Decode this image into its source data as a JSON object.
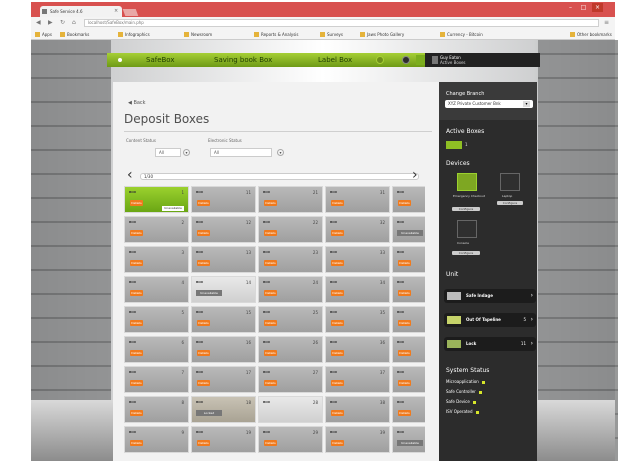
{
  "browser": {
    "tab_title": "Safe Service 4.6",
    "url": "localhost/SafeBox/main.php",
    "bookmarks": [
      "Apps",
      "Bookmarks",
      "Infographics",
      "Newsroom",
      "Reports & Analysis",
      "Surveys",
      "Jaws Photo Gallery",
      "Currency - Bitcoin",
      "Other bookmarks"
    ]
  },
  "topnav": {
    "items": [
      "SafeBox",
      "Saving book Box",
      "Label Box"
    ],
    "user_name": "Guy Eaton",
    "user_status": "Active Boxes"
  },
  "main": {
    "back_label": "Back",
    "title": "Deposit Boxes",
    "filter1_label": "Content Status",
    "filter1_value": "All",
    "filter2_label": "Electronic Status",
    "filter2_value": "All",
    "page_field": "1/30"
  },
  "cells": [
    {
      "num": "1",
      "style": "green",
      "btn": "Details",
      "extra": "Unavailable"
    },
    {
      "num": "11",
      "style": "",
      "btn": "Details"
    },
    {
      "num": "21",
      "style": "",
      "btn": "Details"
    },
    {
      "num": "31",
      "style": "",
      "btn": "Details"
    },
    {
      "num": "41",
      "style": "",
      "btn": "Details"
    },
    {
      "num": "2",
      "style": "",
      "btn": "Details"
    },
    {
      "num": "12",
      "style": "",
      "btn": "Details"
    },
    {
      "num": "22",
      "style": "",
      "btn": "Details"
    },
    {
      "num": "32",
      "style": "",
      "btn": "Details"
    },
    {
      "num": "42",
      "style": "",
      "btn": "Details",
      "tag": "Unavailable"
    },
    {
      "num": "3",
      "style": "",
      "btn": "Details"
    },
    {
      "num": "13",
      "style": "",
      "btn": "Details"
    },
    {
      "num": "23",
      "style": "",
      "btn": "Details"
    },
    {
      "num": "33",
      "style": "",
      "btn": "Details"
    },
    {
      "num": "43",
      "style": "",
      "btn": "Details"
    },
    {
      "num": "4",
      "style": "",
      "btn": "Details"
    },
    {
      "num": "14",
      "style": "light",
      "tag": "Unavailable"
    },
    {
      "num": "24",
      "style": "",
      "btn": "Details"
    },
    {
      "num": "34",
      "style": "",
      "btn": "Details"
    },
    {
      "num": "44",
      "style": "",
      "btn": "Details"
    },
    {
      "num": "5",
      "style": "",
      "btn": "Details"
    },
    {
      "num": "15",
      "style": "",
      "btn": "Details"
    },
    {
      "num": "25",
      "style": "",
      "btn": "Details"
    },
    {
      "num": "35",
      "style": "",
      "btn": "Details"
    },
    {
      "num": "45",
      "style": "",
      "btn": "Details"
    },
    {
      "num": "6",
      "style": "",
      "btn": "Details"
    },
    {
      "num": "16",
      "style": "",
      "btn": "Details"
    },
    {
      "num": "26",
      "style": "",
      "btn": "Details"
    },
    {
      "num": "36",
      "style": "",
      "btn": "Details"
    },
    {
      "num": "46",
      "style": "",
      "btn": "Details"
    },
    {
      "num": "7",
      "style": "",
      "btn": "Details"
    },
    {
      "num": "17",
      "style": "",
      "btn": "Details"
    },
    {
      "num": "27",
      "style": "",
      "btn": "Details"
    },
    {
      "num": "37",
      "style": "",
      "btn": "Details"
    },
    {
      "num": "47",
      "style": "",
      "btn": "Details"
    },
    {
      "num": "8",
      "style": "",
      "btn": "Details"
    },
    {
      "num": "18",
      "style": "tan",
      "tag": "Locked"
    },
    {
      "num": "28",
      "style": "light"
    },
    {
      "num": "38",
      "style": "",
      "btn": "Details"
    },
    {
      "num": "48",
      "style": "",
      "btn": "Details"
    },
    {
      "num": "9",
      "style": "",
      "btn": "Details"
    },
    {
      "num": "19",
      "style": "",
      "btn": "Details"
    },
    {
      "num": "29",
      "style": "",
      "btn": "Details"
    },
    {
      "num": "39",
      "style": "",
      "btn": "Details"
    },
    {
      "num": "49",
      "style": "",
      "btn": "Details",
      "tag": "Unavailable"
    }
  ],
  "cell_id": "BOX",
  "sidebar": {
    "change_branch": "Change Branch",
    "branch_value": "XYZ Private Customer Bnk",
    "active_boxes_label": "Active Boxes",
    "active_boxes_count": "1",
    "devices_label": "Devices",
    "device1_label": "Emergency Checkout",
    "device1_btn": "Configure",
    "device2_label": "Laptop",
    "device2_btn": "Configure",
    "device3_label": "Console",
    "device3_btn": "Configure",
    "unit_label": "Unit",
    "units": [
      {
        "label": "Safe Indage",
        "count": ""
      },
      {
        "label": "Out Of Tapeline",
        "count": "5"
      },
      {
        "label": "Lock",
        "count": "11"
      }
    ],
    "system_status_label": "System Status",
    "statuses": [
      "Microapplication",
      "Safe Controller",
      "Safe Device",
      "ISV Operated"
    ]
  }
}
